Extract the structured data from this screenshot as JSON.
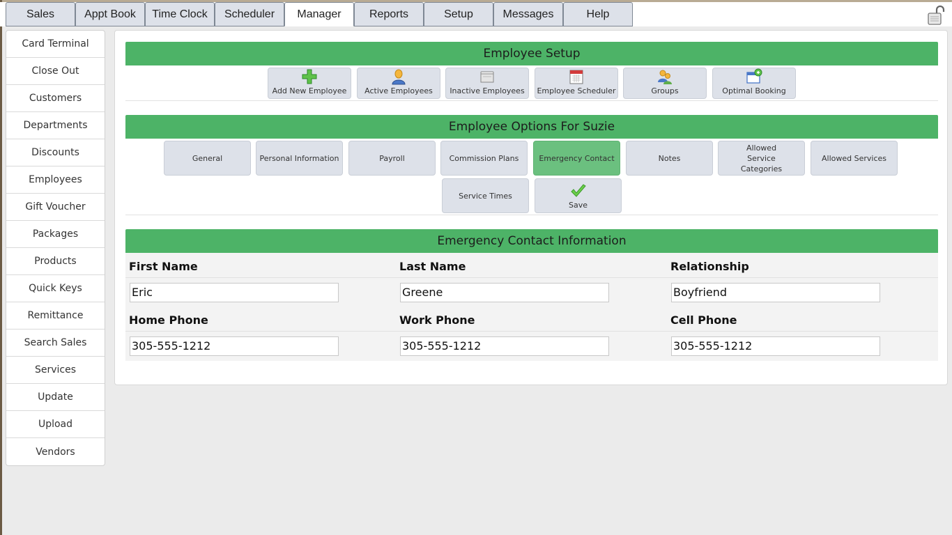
{
  "topnav": {
    "tabs": [
      {
        "label": "Sales"
      },
      {
        "label": "Appt Book"
      },
      {
        "label": "Time Clock"
      },
      {
        "label": "Scheduler"
      },
      {
        "label": "Manager"
      },
      {
        "label": "Reports"
      },
      {
        "label": "Setup"
      },
      {
        "label": "Messages"
      },
      {
        "label": "Help"
      }
    ],
    "active_tab": "Manager",
    "lock_icon": "padlock-open-icon"
  },
  "sidebar": {
    "items": [
      {
        "label": "Card Terminal"
      },
      {
        "label": "Close Out"
      },
      {
        "label": "Customers"
      },
      {
        "label": "Departments"
      },
      {
        "label": "Discounts"
      },
      {
        "label": "Employees"
      },
      {
        "label": "Gift Voucher"
      },
      {
        "label": "Packages"
      },
      {
        "label": "Products"
      },
      {
        "label": "Quick Keys"
      },
      {
        "label": "Remittance"
      },
      {
        "label": "Search Sales"
      },
      {
        "label": "Services"
      },
      {
        "label": "Update"
      },
      {
        "label": "Upload"
      },
      {
        "label": "Vendors"
      }
    ]
  },
  "employee_setup": {
    "title": "Employee Setup",
    "buttons": [
      {
        "label": "Add New Employee",
        "icon": "green-plus-icon"
      },
      {
        "label": "Active Employees",
        "icon": "person-icon"
      },
      {
        "label": "Inactive Employees",
        "icon": "folder-icon"
      },
      {
        "label": "Employee Scheduler",
        "icon": "calendar-icon"
      },
      {
        "label": "Groups",
        "icon": "group-icon"
      },
      {
        "label": "Optimal Booking",
        "icon": "booking-icon"
      }
    ]
  },
  "employee_options": {
    "title": "Employee Options For Suzie",
    "buttons": [
      {
        "label": "General"
      },
      {
        "label": "Personal Information"
      },
      {
        "label": "Payroll"
      },
      {
        "label": "Commission Plans"
      },
      {
        "label": "Emergency Contact"
      },
      {
        "label": "Notes"
      },
      {
        "label": "Allowed Service Categories"
      },
      {
        "label": "Allowed Services"
      },
      {
        "label": "Service Times"
      },
      {
        "label": "Save",
        "icon": "checkmark-icon"
      }
    ],
    "active_button": "Emergency Contact"
  },
  "emergency_contact": {
    "title": "Emergency Contact Information",
    "fields": {
      "first_name": {
        "label": "First Name",
        "value": "Eric"
      },
      "last_name": {
        "label": "Last Name",
        "value": "Greene"
      },
      "relationship": {
        "label": "Relationship",
        "value": "Boyfriend"
      },
      "home_phone": {
        "label": "Home Phone",
        "value": "305-555-1212"
      },
      "work_phone": {
        "label": "Work Phone",
        "value": "305-555-1212"
      },
      "cell_phone": {
        "label": "Cell Phone",
        "value": "305-555-1212"
      }
    }
  },
  "colors": {
    "section_header": "#4db367",
    "active_option": "#6bc07f",
    "button_bg": "#dde1e9",
    "page_bg": "#ebebeb"
  }
}
